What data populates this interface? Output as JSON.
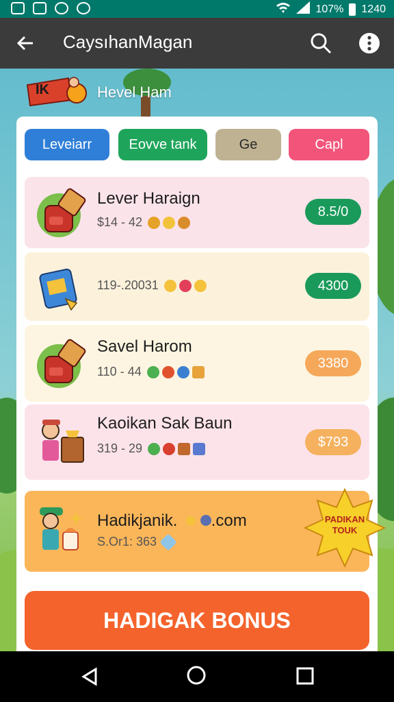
{
  "status_bar": {
    "battery": "107%",
    "time": "1240"
  },
  "app_bar": {
    "title": "CaysıhanMagan"
  },
  "level": {
    "badge_text": "IK",
    "title": "Hevel Ham"
  },
  "tabs": [
    {
      "label": "Leveiarr",
      "color": "#2f7fd8"
    },
    {
      "label": "Eovve tank",
      "color": "#1fa55b"
    },
    {
      "label": "Ge",
      "color": "#bfb293"
    },
    {
      "label": "Capl",
      "color": "#f2547a"
    }
  ],
  "items": [
    {
      "title": "Lever Haraign",
      "subtitle": "$14 - 42",
      "price": "8.5/0",
      "bg": "#fbe3ea",
      "price_color": "#1a9a5a",
      "icon": "backpack-icon"
    },
    {
      "title": "",
      "subtitle": "119-.20031",
      "price": "4300",
      "bg": "#fcf2dc",
      "price_color": "#1a9a5a",
      "icon": "suitcase-icon"
    },
    {
      "title": "Savel Harom",
      "subtitle": "110 - 44",
      "price": "3380",
      "bg": "#fdf5e1",
      "price_color": "#f6a85a",
      "icon": "backpack-icon"
    },
    {
      "title": "Kaoikan Sak Baun",
      "subtitle": "319 - 29",
      "price": "$793",
      "bg": "#fce3ea",
      "price_color": "#f5b15e",
      "icon": "shopkeeper-icon"
    }
  ],
  "featured": {
    "title": "Hadikjanik.",
    "title_suffix": ".com",
    "subtitle": "S.Or1: 363",
    "star_text": "PADIKAN TOUK",
    "bg": "#fbb65a"
  },
  "bonus_button": {
    "label": "HADIGAK BONUS"
  }
}
